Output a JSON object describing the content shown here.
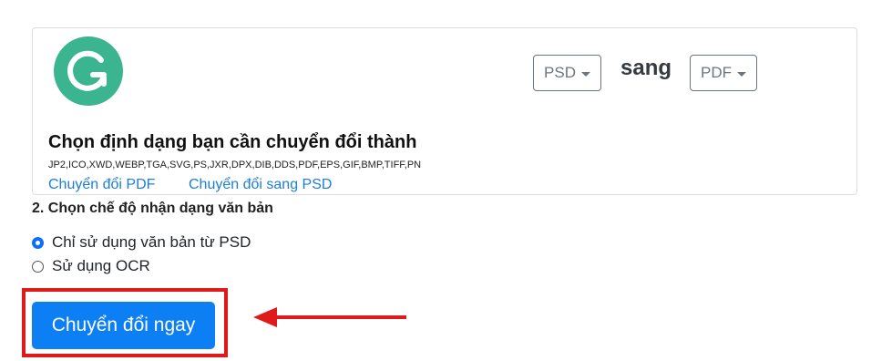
{
  "converter": {
    "from_format": "PSD",
    "connector": "sang",
    "to_format": "PDF",
    "heading": "Chọn định dạng bạn cần chuyển đổi thành",
    "formats_list": "JP2,ICO,XWD,WEBP,TGA,SVG,PS,JXR,DPX,DIB,DDS,PDF,EPS,GIF,BMP,TIFF,PN",
    "links": [
      "Chuyển đổi PDF",
      "Chuyển đổi sang PSD"
    ]
  },
  "ocr_section": {
    "title": "2. Chọn chế độ nhận dạng văn bản",
    "options": [
      {
        "label": "Chỉ sử dụng văn bản từ PSD",
        "checked": true
      },
      {
        "label": "Sử dụng OCR",
        "checked": false
      }
    ]
  },
  "action": {
    "convert_label": "Chuyển đổi ngay"
  },
  "colors": {
    "logo": "#3bb58f",
    "button": "#0d7ff5",
    "highlight": "#e01a1a",
    "link": "#1e7ed4"
  }
}
